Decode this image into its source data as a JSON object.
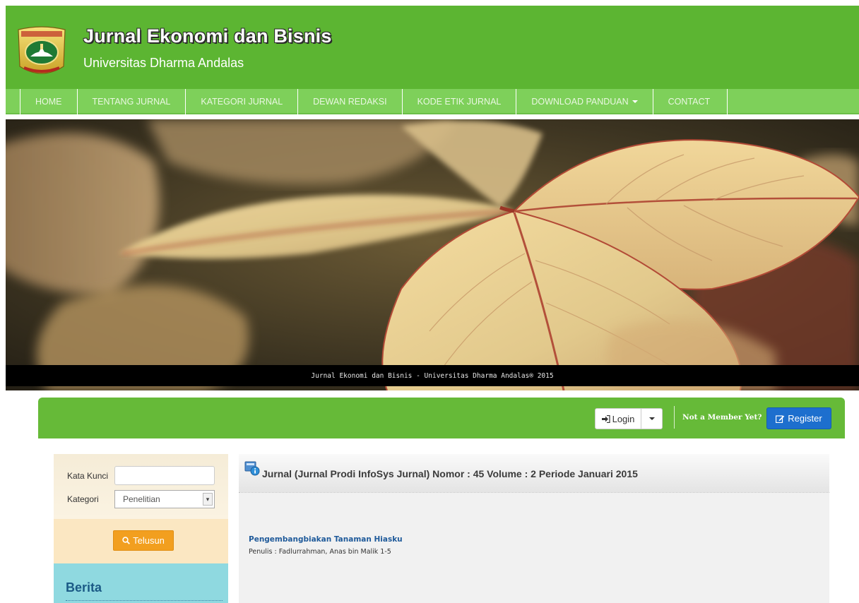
{
  "header": {
    "title": "Jurnal Ekonomi dan Bisnis",
    "subtitle": "Universitas Dharma Andalas",
    "brand_color": "#5cb532"
  },
  "nav": {
    "items": [
      {
        "label": "HOME"
      },
      {
        "label": "TENTANG JURNAL"
      },
      {
        "label": "KATEGORI JURNAL"
      },
      {
        "label": "DEWAN REDAKSI"
      },
      {
        "label": "KODE ETIK JURNAL"
      },
      {
        "label": "DOWNLOAD PANDUAN"
      },
      {
        "label": "CONTACT"
      }
    ]
  },
  "hero": {
    "caption": "Jurnal Ekonomi dan Bisnis - Universitas Dharma Andalas® 2015"
  },
  "member_bar": {
    "login_label": "Login",
    "not_member_text": "Not a Member Yet?",
    "register_label": "Register"
  },
  "search": {
    "keyword_label": "Kata Kunci",
    "keyword_value": "",
    "category_label": "Kategori",
    "category_value": "Penelitian",
    "button_label": "Telusun"
  },
  "news": {
    "title": "Berita"
  },
  "journal": {
    "heading": "Jurnal (Jurnal Prodi InfoSys Jurnal) Nomor : 45 Volume : 2 Periode Januari 2015",
    "articles": [
      {
        "title": "Pengembangbiakan Tanaman Hiasku",
        "author_line": "Penulis : Fadlurrahman, Anas bin Malik 1-5"
      }
    ]
  },
  "icons": {
    "login": "sign-in-icon",
    "register": "edit-icon",
    "search": "search-icon",
    "journal": "journal-info-icon"
  }
}
